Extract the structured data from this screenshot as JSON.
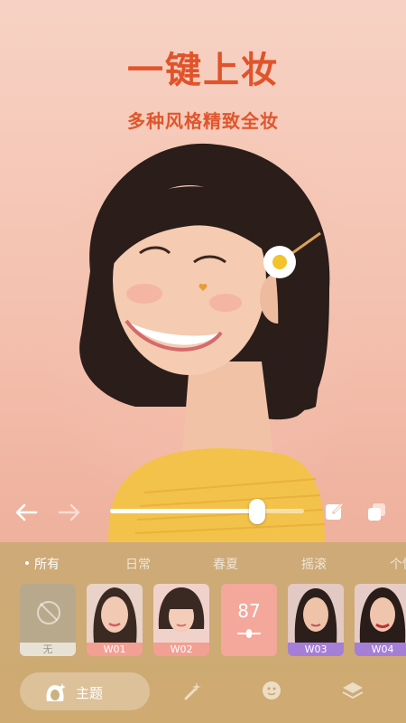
{
  "header": {
    "title": "一键上妆",
    "subtitle": "多种风格精致全妆"
  },
  "controls": {
    "undo_icon": "arrow-left-icon",
    "redo_icon": "arrow-right-icon",
    "intensity_fraction": 0.76,
    "edit_icon": "edit-icon",
    "compare_icon": "compare-icon"
  },
  "categories": [
    {
      "label": "所有",
      "active": true
    },
    {
      "label": "日常",
      "active": false
    },
    {
      "label": "春夏",
      "active": false
    },
    {
      "label": "摇滚",
      "active": false
    },
    {
      "label": "个性",
      "active": false
    }
  ],
  "looks": {
    "none_label": "无",
    "strength_value": "87",
    "items": [
      {
        "label": "W01",
        "color": "#f29f94"
      },
      {
        "label": "W02",
        "color": "#f29f94"
      },
      {
        "label": "W03",
        "color": "#a57ed8"
      },
      {
        "label": "W04",
        "color": "#a57ed8"
      }
    ]
  },
  "tabbar": {
    "theme_label": "主题",
    "tabs": [
      "magic-wand-icon",
      "face-icon",
      "layers-icon"
    ]
  },
  "colors": {
    "accent": "#e1532a",
    "panel": "#c8a86e"
  }
}
